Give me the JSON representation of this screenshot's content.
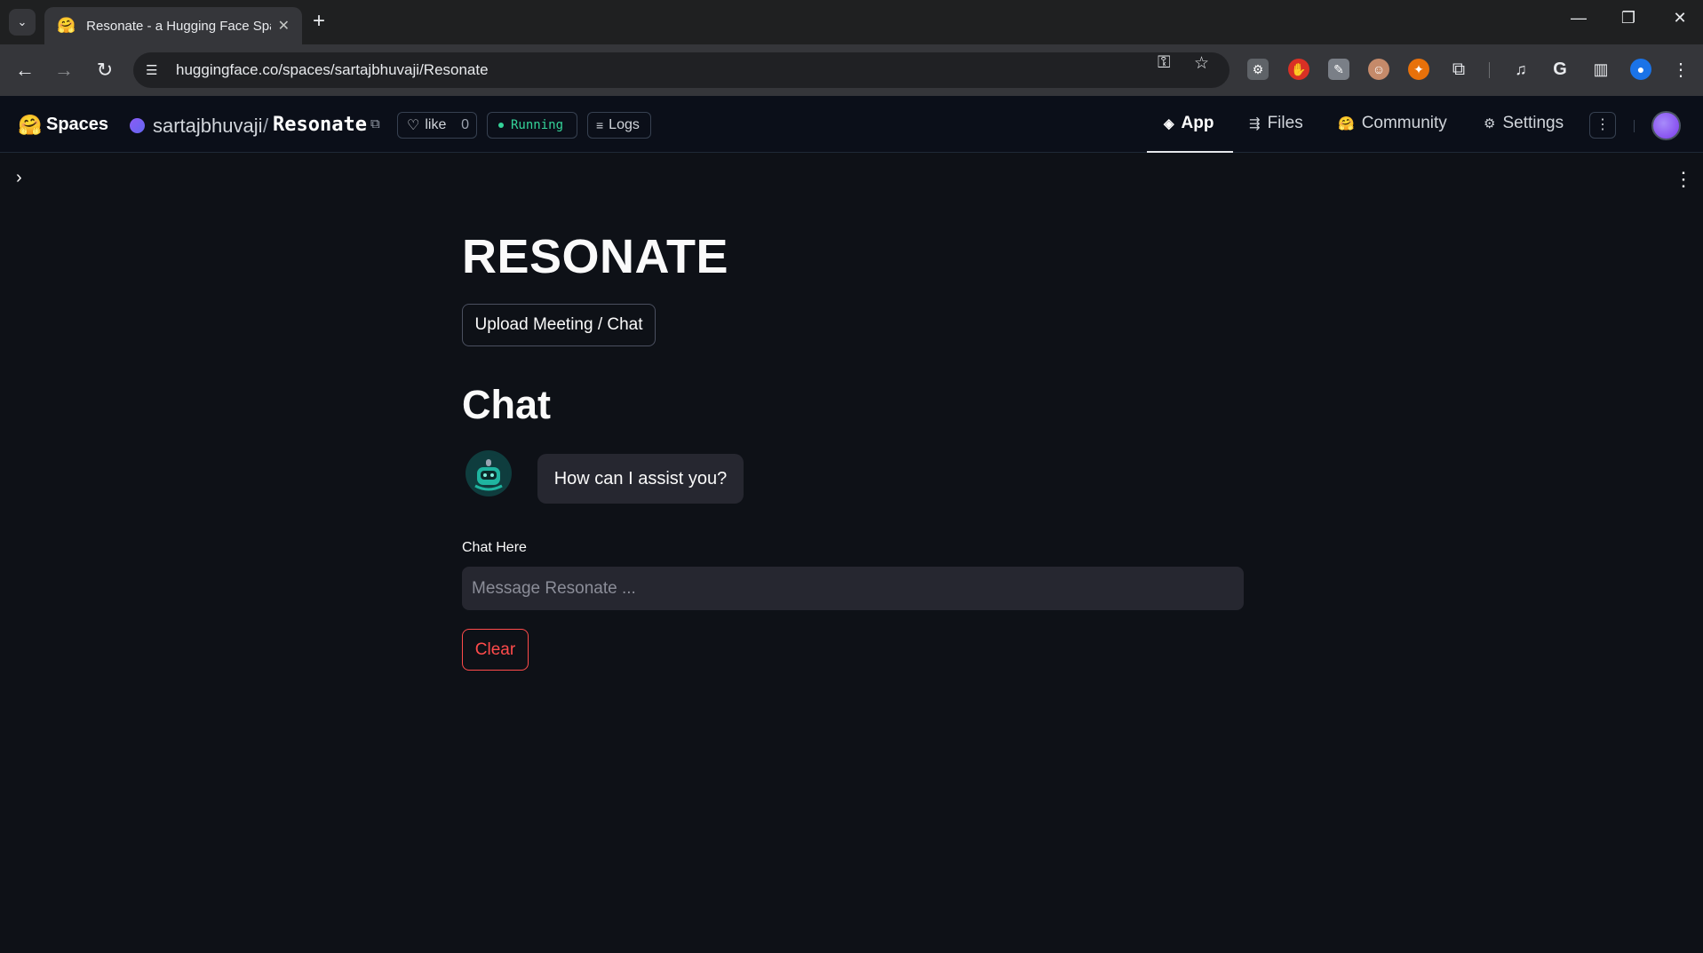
{
  "browser": {
    "tab_title": "Resonate - a Hugging Face Spa",
    "tab_favicon": "🤗",
    "url": "huggingface.co/spaces/sartajbhuvaji/Resonate"
  },
  "hf_header": {
    "logo": "🤗",
    "spaces_label": "Spaces",
    "owner": "sartajbhuvaji",
    "slash": "/",
    "repo": "Resonate",
    "like_label": "like",
    "like_count": "0",
    "status": "Running",
    "logs_label": "Logs",
    "nav": {
      "app": "App",
      "files": "Files",
      "community": "Community",
      "settings": "Settings"
    }
  },
  "app": {
    "title": "RESONATE",
    "upload_button": "Upload Meeting / Chat",
    "chat_heading": "Chat",
    "assistant_message": "How can I assist you?",
    "input_label": "Chat Here",
    "input_placeholder": "Message Resonate ...",
    "clear_button": "Clear"
  },
  "colors": {
    "app_bg": "#0e1117",
    "accent_red": "#ff4b4b",
    "running_green": "#34d399"
  }
}
